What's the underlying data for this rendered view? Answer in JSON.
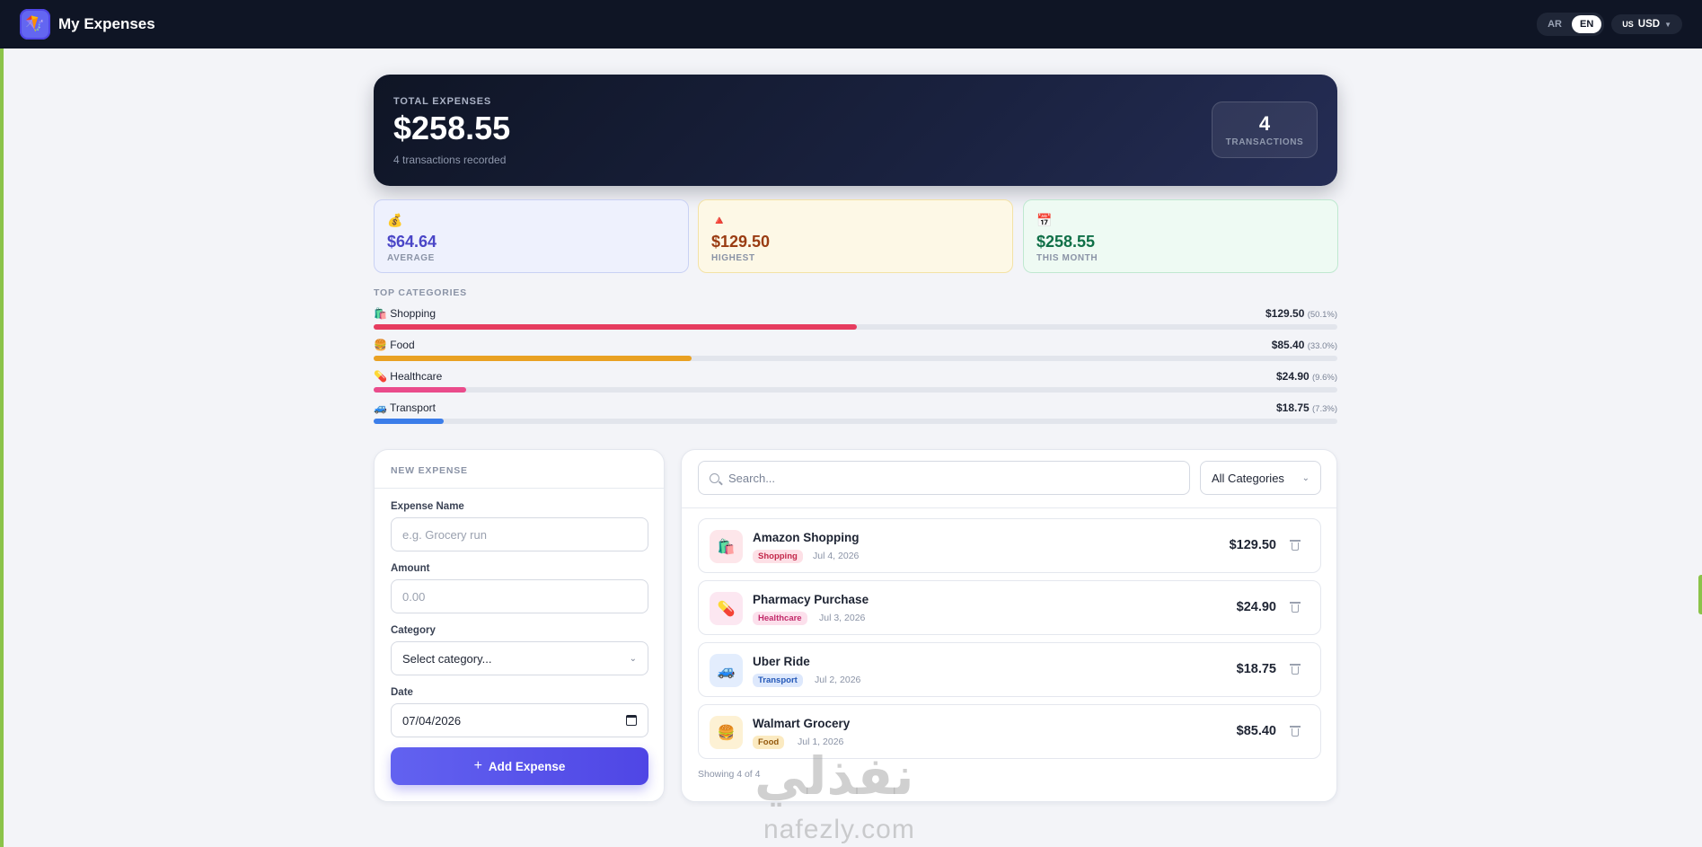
{
  "header": {
    "app_title": "My Expenses",
    "logo_icon": "🪁",
    "lang_ar": "AR",
    "lang_en": "EN",
    "currency_flag": "US",
    "currency": "USD"
  },
  "total": {
    "label": "TOTAL EXPENSES",
    "amount": "$258.55",
    "subtitle": "4 transactions recorded",
    "tx_count": "4",
    "tx_label": "TRANSACTIONS"
  },
  "stats": [
    {
      "icon": "💰",
      "value": "$64.64",
      "label": "AVERAGE"
    },
    {
      "icon": "🔺",
      "value": "$129.50",
      "label": "HIGHEST"
    },
    {
      "icon": "📅",
      "value": "$258.55",
      "label": "THIS MONTH"
    }
  ],
  "top_categories": {
    "title": "TOP CATEGORIES",
    "items": [
      {
        "name": "🛍️ Shopping",
        "amount": "$129.50",
        "pct": "(50.1%)",
        "fraction": 0.501,
        "color": "#e63c5f"
      },
      {
        "name": "🍔 Food",
        "amount": "$85.40",
        "pct": "(33.0%)",
        "fraction": 0.33,
        "color": "#e9a123"
      },
      {
        "name": "💊 Healthcare",
        "amount": "$24.90",
        "pct": "(9.6%)",
        "fraction": 0.096,
        "color": "#ea4b8b"
      },
      {
        "name": "🚙 Transport",
        "amount": "$18.75",
        "pct": "(7.3%)",
        "fraction": 0.073,
        "color": "#3b7de9"
      }
    ]
  },
  "form": {
    "title": "NEW EXPENSE",
    "name_label": "Expense Name",
    "name_placeholder": "e.g. Grocery run",
    "amount_label": "Amount",
    "amount_placeholder": "0.00",
    "category_label": "Category",
    "category_value": "Select category...",
    "date_label": "Date",
    "date_value": "07/04/2026",
    "submit_label": "Add Expense"
  },
  "list": {
    "search_placeholder": "Search...",
    "filter_value": "All Categories",
    "footer": "Showing 4 of 4",
    "expenses": [
      {
        "icon": "🛍️",
        "name": "Amazon Shopping",
        "category": "Shopping",
        "date": "Jul 4, 2026",
        "amount": "$129.50",
        "icon_bg": "#fde6ea",
        "badge_bg": "#fde0e6",
        "badge_fg": "#c3284a"
      },
      {
        "icon": "💊",
        "name": "Pharmacy Purchase",
        "category": "Healthcare",
        "date": "Jul 3, 2026",
        "amount": "$24.90",
        "icon_bg": "#fce7f1",
        "badge_bg": "#fce0ec",
        "badge_fg": "#c22a6a"
      },
      {
        "icon": "🚙",
        "name": "Uber Ride",
        "category": "Transport",
        "date": "Jul 2, 2026",
        "amount": "$18.75",
        "icon_bg": "#e3edfd",
        "badge_bg": "#dde8fc",
        "badge_fg": "#2458b8"
      },
      {
        "icon": "🍔",
        "name": "Walmart Grocery",
        "category": "Food",
        "date": "Jul 1, 2026",
        "amount": "$85.40",
        "icon_bg": "#fdf1d4",
        "badge_bg": "#fbeac1",
        "badge_fg": "#93580c"
      }
    ]
  },
  "watermark": {
    "arabic": "نفذلي",
    "latin": "nafezly.com"
  }
}
